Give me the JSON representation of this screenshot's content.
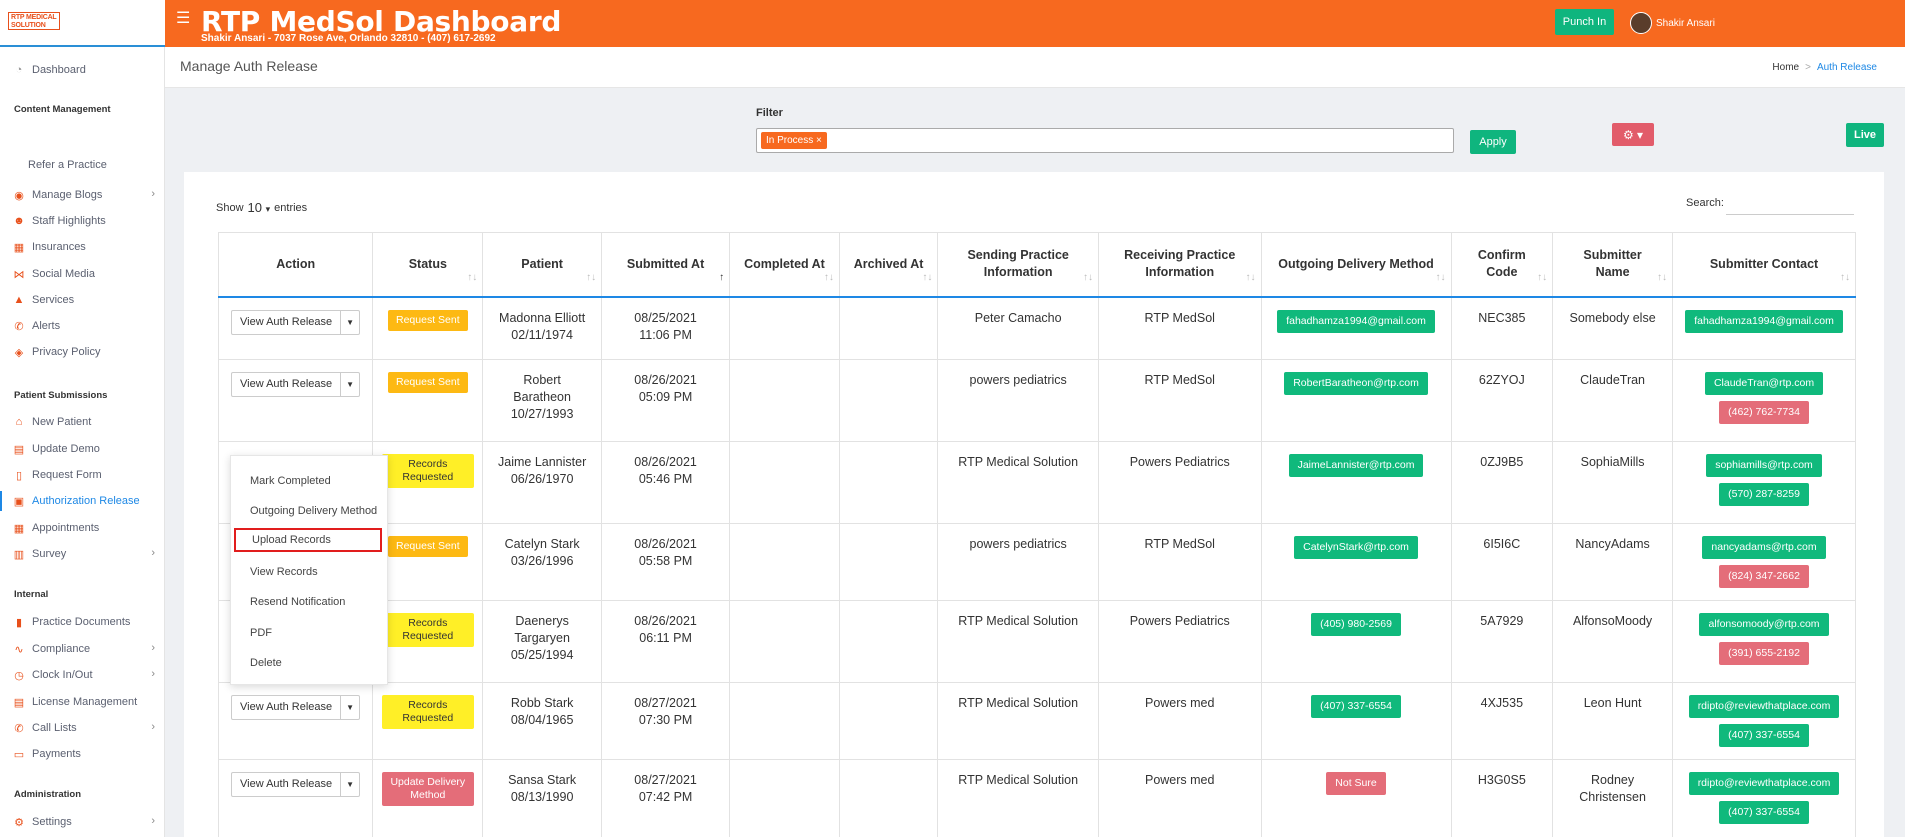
{
  "brand": {
    "logo_text": "RTP MEDICAL SOLUTION",
    "app_title": "RTP MedSol Dashboard",
    "subtitle": "Shakir Ansari - 7037 Rose Ave, Orlando 32810 - (407) 617-2692",
    "accent_color": "#f7691f"
  },
  "header": {
    "punch_in_label": "Punch In",
    "user_name": "Shakir Ansari"
  },
  "sidebar": {
    "dashboard": "Dashboard",
    "content_management": "Content Management",
    "refer": "Refer a Practice",
    "manage_blogs": "Manage Blogs",
    "staff_highlights": "Staff Highlights",
    "insurances": "Insurances",
    "social_media": "Social Media",
    "services": "Services",
    "alerts": "Alerts",
    "privacy_policy": "Privacy Policy",
    "patient_submissions": "Patient Submissions",
    "new_patient": "New Patient",
    "update_demo": "Update Demo",
    "request_form": "Request Form",
    "authorization_release": "Authorization Release",
    "appointments": "Appointments",
    "survey": "Survey",
    "internal": "Internal",
    "practice_documents": "Practice Documents",
    "compliance": "Compliance",
    "clock_in_out": "Clock In/Out",
    "license_management": "License Management",
    "call_lists": "Call Lists",
    "payments": "Payments",
    "administration": "Administration",
    "settings": "Settings"
  },
  "page": {
    "title": "Manage Auth Release",
    "breadcrumb_home": "Home",
    "breadcrumb_current": "Auth Release"
  },
  "filter": {
    "label": "Filter",
    "chip": "In Process ×",
    "apply_label": "Apply",
    "live_label": "Live"
  },
  "table": {
    "show_label": "Show",
    "entries_value": "10",
    "entries_label": "entries",
    "search_label": "Search:",
    "headers": {
      "action": "Action",
      "status": "Status",
      "patient": "Patient",
      "submitted_at": "Submitted At",
      "completed_at": "Completed At",
      "archived_at": "Archived At",
      "sending": "Sending Practice Information",
      "receiving": "Receiving Practice Information",
      "delivery": "Outgoing Delivery Method",
      "confirm": "Confirm Code",
      "submitter_name": "Submitter Name",
      "submitter_contact": "Submitter Contact"
    },
    "view_button_label": "View Auth Release",
    "rows": [
      {
        "status": "Request Sent",
        "patient_name": "Madonna Elliott",
        "dob": "02/11/1974",
        "date": "08/25/2021",
        "time": "11:06 PM",
        "sending": "Peter Camacho",
        "receiving": "RTP MedSol",
        "delivery": "fahadhamza1994@gmail.com",
        "confirm": "NEC385",
        "submitter": "Somebody else",
        "contact_email": "fahadhamza1994@gmail.com",
        "contact_phone": ""
      },
      {
        "status": "Request Sent",
        "patient_name": "Robert Baratheon",
        "dob": "10/27/1993",
        "date": "08/26/2021",
        "time": "05:09 PM",
        "sending": "powers pediatrics",
        "receiving": "RTP MedSol",
        "delivery": "RobertBaratheon@rtp.com",
        "confirm": "62ZYOJ",
        "submitter": "ClaudeTran",
        "contact_email": "ClaudeTran@rtp.com",
        "contact_phone": "(462) 762-7734"
      },
      {
        "status": "Records Requested",
        "patient_name": "Jaime Lannister",
        "dob": "06/26/1970",
        "date": "08/26/2021",
        "time": "05:46 PM",
        "sending": "RTP Medical Solution",
        "receiving": "Powers Pediatrics",
        "delivery": "JaimeLannister@rtp.com",
        "confirm": "0ZJ9B5",
        "submitter": "SophiaMills",
        "contact_email": "sophiamills@rtp.com",
        "contact_phone": "(570) 287-8259"
      },
      {
        "status": "Request Sent",
        "patient_name": "Catelyn Stark",
        "dob": "03/26/1996",
        "date": "08/26/2021",
        "time": "05:58 PM",
        "sending": "powers pediatrics",
        "receiving": "RTP MedSol",
        "delivery": "CatelynStark@rtp.com",
        "confirm": "6I5I6C",
        "submitter": "NancyAdams",
        "contact_email": "nancyadams@rtp.com",
        "contact_phone": "(824) 347-2662"
      },
      {
        "status": "Records Requested",
        "patient_name": "Daenerys Targaryen",
        "dob": "05/25/1994",
        "date": "08/26/2021",
        "time": "06:11 PM",
        "sending": "RTP Medical Solution",
        "receiving": "Powers Pediatrics",
        "delivery": "(405) 980-2569",
        "confirm": "5A7929",
        "submitter": "AlfonsoMoody",
        "contact_email": "alfonsomoody@rtp.com",
        "contact_phone": "(391) 655-2192"
      },
      {
        "status": "Records Requested",
        "patient_name": "Robb Stark",
        "dob": "08/04/1965",
        "date": "08/27/2021",
        "time": "07:30 PM",
        "sending": "RTP Medical Solution",
        "receiving": "Powers med",
        "delivery": "(407) 337-6554",
        "confirm": "4XJ535",
        "submitter": "Leon Hunt",
        "contact_email": "rdipto@reviewthatplace.com",
        "contact_phone": "(407) 337-6554"
      },
      {
        "status": "Update Delivery Method",
        "patient_name": "Sansa Stark",
        "dob": "08/13/1990",
        "date": "08/27/2021",
        "time": "07:42 PM",
        "sending": "RTP Medical Solution",
        "receiving": "Powers med",
        "delivery": "Not Sure",
        "confirm": "H3G0S5",
        "submitter": "Rodney Christensen",
        "contact_email": "rdipto@reviewthatplace.com",
        "contact_phone": "(407) 337-6554"
      }
    ]
  },
  "menu": {
    "items": [
      "Mark Completed",
      "Outgoing Delivery Method",
      "Upload Records",
      "View Records",
      "Resend Notification",
      "PDF",
      "Delete"
    ]
  },
  "colors": {
    "green": "#10b97c",
    "red": "#e46d79",
    "yellow": "#fdb913",
    "lime": "#ffef27",
    "link_blue": "#1e88e5"
  }
}
